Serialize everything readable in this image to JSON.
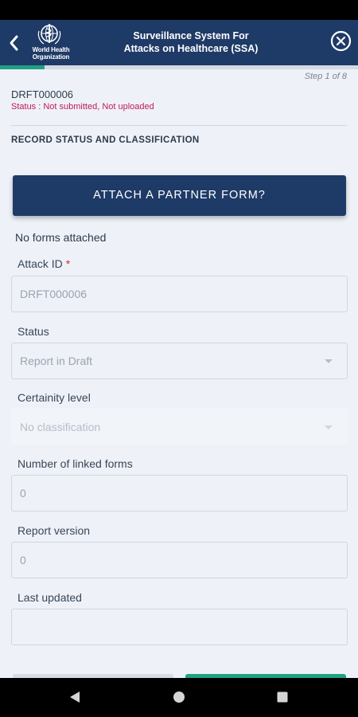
{
  "header": {
    "title_line1": "Surveillance System For",
    "title_line2": "Attacks on Healthcare (SSA)",
    "org_line1": "World Health",
    "org_line2": "Organization",
    "back_icon": "chevron-left-icon",
    "close_icon": "close-circle-icon"
  },
  "progress": {
    "fraction": 0.125,
    "step_label": "Step 1 of 8"
  },
  "record": {
    "id": "DRFT000006",
    "status": "Status : Not submitted, Not uploaded"
  },
  "section": {
    "title": "RECORD STATUS AND CLASSIFICATION"
  },
  "attach": {
    "button_label": "ATTACH A PARTNER FORM?",
    "empty_text": "No forms attached"
  },
  "fields": {
    "attack_id": {
      "label": "Attack ID",
      "required": "*",
      "value": "DRFT000006"
    },
    "status": {
      "label": "Status",
      "value": "Report in Draft"
    },
    "certainty": {
      "label": "Certainity level",
      "value": "No classification"
    },
    "linked_forms": {
      "label": "Number of linked forms",
      "value": "0"
    },
    "report_version": {
      "label": "Report version",
      "value": "0"
    },
    "last_updated": {
      "label": "Last updated",
      "value": ""
    }
  },
  "colors": {
    "header_bg": "#1e3a66",
    "accent_green": "#1fa184",
    "status_pink": "#c2185b",
    "page_bg": "#eef2f8"
  },
  "nav": {
    "back_icon": "triangle-back-icon",
    "home_icon": "circle-home-icon",
    "recents_icon": "square-recents-icon"
  }
}
